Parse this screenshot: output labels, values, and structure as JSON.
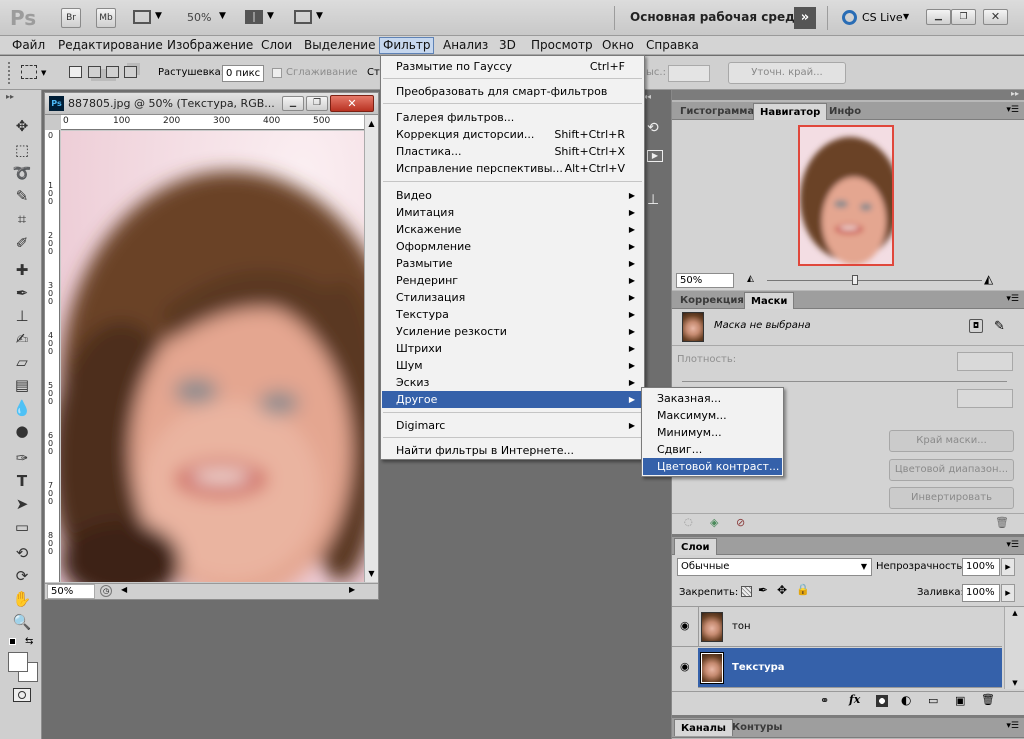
{
  "appbar": {
    "logo": "Ps",
    "bridge": "Br",
    "minibridge": "Mb",
    "zoom": "50%",
    "workspace": "Основная рабочая среда",
    "cslive": "CS Live"
  },
  "menubar": {
    "items": [
      "Файл",
      "Редактирование",
      "Изображение",
      "Слои",
      "Выделение",
      "Фильтр",
      "Анализ",
      "3D",
      "Просмотр",
      "Окно",
      "Справка"
    ],
    "active": "Фильтр"
  },
  "options": {
    "feather_label": "Растушевка:",
    "feather_value": "0 пикс",
    "antialias_label": "Сглаживание",
    "style_label": "Ст",
    "height_label": "ыс.:",
    "refine_edge": "Уточн. край..."
  },
  "document": {
    "title": "887805.jpg @ 50% (Текстура, RGB...",
    "ps_badge": "Ps",
    "ruler_top": [
      "0",
      "100",
      "200",
      "300",
      "400",
      "500"
    ],
    "ruler_left": [
      "0",
      "1 0 0",
      "2 0 0",
      "3 0 0",
      "4 0 0",
      "5 0 0",
      "6 0 0",
      "7 0 0",
      "8 0 0"
    ],
    "zoom": "50%"
  },
  "filter_menu": {
    "top": [
      {
        "label": "Размытие по Гауссу",
        "shortcut": "Ctrl+F"
      }
    ],
    "smart": [
      {
        "label": "Преобразовать для смарт-фильтров",
        "shortcut": ""
      }
    ],
    "group1": [
      {
        "label": "Галерея фильтров...",
        "shortcut": ""
      },
      {
        "label": "Коррекция дисторсии...",
        "shortcut": "Shift+Ctrl+R"
      },
      {
        "label": "Пластика...",
        "shortcut": "Shift+Ctrl+X"
      },
      {
        "label": "Исправление перспективы...",
        "shortcut": "Alt+Ctrl+V"
      }
    ],
    "groups": [
      "Видео",
      "Имитация",
      "Искажение",
      "Оформление",
      "Размытие",
      "Рендеринг",
      "Стилизация",
      "Текстура",
      "Усиление резкости",
      "Штрихи",
      "Шум",
      "Эскиз",
      "Другое"
    ],
    "highlighted": "Другое",
    "digimarc": "Digimarc",
    "online": "Найти фильтры в Интернете..."
  },
  "other_submenu": {
    "items": [
      "Заказная...",
      "Максимум...",
      "Минимум...",
      "Сдвиг...",
      "Цветовой контраст..."
    ],
    "highlighted": "Цветовой контраст..."
  },
  "navigator_panel": {
    "tabs": [
      "Гистограмма",
      "Навигатор",
      "Инфо"
    ],
    "active": "Навигатор",
    "zoom": "50%"
  },
  "masks_panel": {
    "tabs": [
      "Коррекция",
      "Маски"
    ],
    "active": "Маски",
    "mask_status": "Маска не выбрана",
    "density_label": "Плотность:",
    "buttons": [
      "Край маски...",
      "Цветовой диапазон...",
      "Инвертировать"
    ]
  },
  "layers_panel": {
    "tab": "Слои",
    "blend_mode": "Обычные",
    "opacity_label": "Непрозрачность:",
    "opacity": "100%",
    "lock_label": "Закрепить:",
    "fill_label": "Заливка:",
    "fill": "100%",
    "layers": [
      {
        "name": "тон",
        "selected": false
      },
      {
        "name": "Текстура",
        "selected": true
      }
    ]
  },
  "bottom_panel": {
    "tabs": [
      "Каналы",
      "Контуры"
    ],
    "active": "Каналы"
  }
}
